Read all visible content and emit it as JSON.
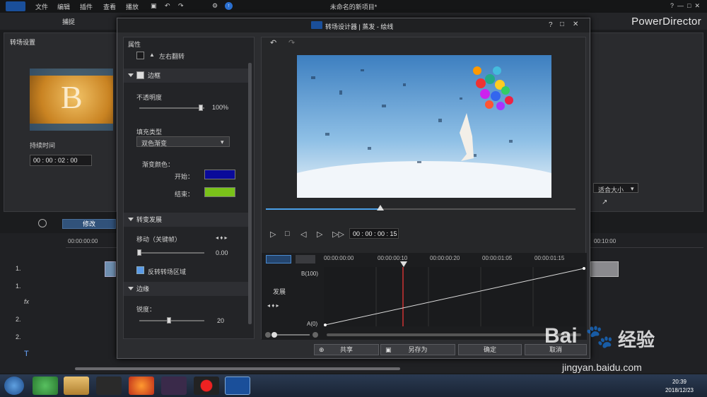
{
  "menu": {
    "file": "文件",
    "edit": "编辑",
    "plugins": "插件",
    "view": "查看",
    "play": "播放"
  },
  "app_title": "未命名的新项目*",
  "brand": "PowerDirector",
  "top_tabs": {
    "capture": "捕捉"
  },
  "left_panel": {
    "title": "转场设置",
    "duration_label": "持续时间",
    "duration_value": "00 : 00 : 02 : 00",
    "thumb_letter": "B"
  },
  "right_strip": {
    "fit_label": "适合大小"
  },
  "edit_button": "修改",
  "timeline": {
    "start_time": "00:00:00:00",
    "right_time": "00:10:00",
    "tracks": [
      "1.",
      "1.",
      "fx",
      "2.",
      "2.",
      "T"
    ]
  },
  "dialog": {
    "title": "转场设计器 | 蒸发 - 绘线",
    "properties_label": "属性",
    "flip_label": "左右翻转",
    "border": {
      "section": "边框",
      "opacity_label": "不透明度",
      "opacity_value": "100%",
      "opacity_fraction": 1.0,
      "fill_type_label": "填充类型",
      "fill_type_value": "双色渐变",
      "gradient_label": "渐变颜色：",
      "start_label": "开始：",
      "end_label": "结束：",
      "start_color": "#0a0a9a",
      "end_color": "#7ac21a"
    },
    "transition_dev": {
      "section": "转变发展",
      "move_label": "移动（关键帧）",
      "move_value": "0.00",
      "invert_label": "反转转场区域"
    },
    "edge": {
      "section": "边缘",
      "sharpness_label": "锐度：",
      "sharpness_value": "20",
      "sharpness_fraction": 0.45
    },
    "playback": {
      "timecode": "00 : 00 : 00 : 15",
      "progress_fraction": 0.37
    },
    "keyframes": {
      "ticks": [
        "00:00:00:00",
        "00:00:00:10",
        "00:00:00:20",
        "00:00:01:05",
        "00:00:01:15"
      ],
      "y_top": "B(100)",
      "y_bottom": "A(0)",
      "row_label": "发展"
    },
    "buttons": {
      "share": "共享",
      "save_as": "另存为",
      "ok": "确定",
      "cancel": "取消"
    }
  },
  "taskbar": {
    "time": "20:39",
    "date": "2018/12/23"
  },
  "watermark": {
    "site": "jingyan.baidu.com",
    "brand": "经验"
  }
}
